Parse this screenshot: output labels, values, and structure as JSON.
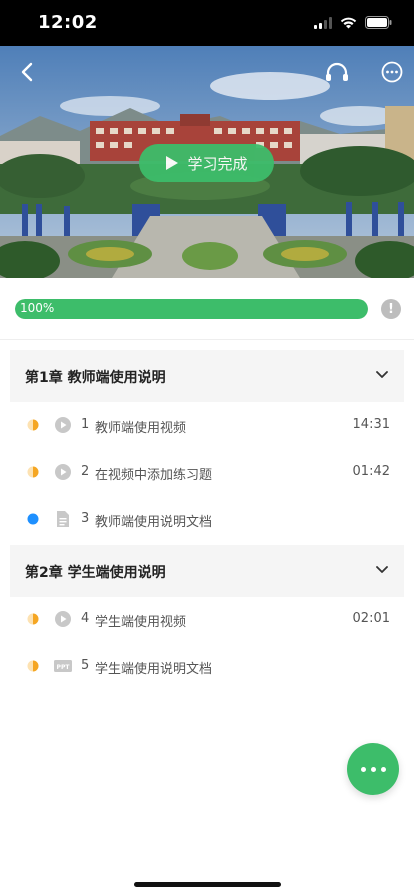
{
  "status_bar": {
    "time": "12:02"
  },
  "hero": {
    "play_label": "学习完成",
    "back_icon": "chevron-left-icon",
    "headphone_icon": "headphones-icon",
    "more_icon": "more-circle-icon"
  },
  "progress": {
    "value": 1.0,
    "label": "100%",
    "color": "#3dbd6a",
    "info_icon": "!"
  },
  "chapters": [
    {
      "title": "第1章  教师端使用说明"
    },
    {
      "title": "第2章  学生端使用说明"
    }
  ],
  "lessons": [
    {
      "num": "1",
      "title": "教师端使用视频",
      "duration": "14:31",
      "status": "half",
      "type": "video"
    },
    {
      "num": "2",
      "title": "在视频中添加练习题",
      "duration": "01:42",
      "status": "half",
      "type": "video"
    },
    {
      "num": "3",
      "title": "教师端使用说明文档",
      "duration": "",
      "status": "blue",
      "type": "doc"
    },
    {
      "num": "4",
      "title": "学生端使用视频",
      "duration": "02:01",
      "status": "half",
      "type": "video"
    },
    {
      "num": "5",
      "title": "学生端使用说明文档",
      "duration": "",
      "status": "half",
      "type": "ppt"
    }
  ],
  "colors": {
    "accent": "#3dbd6a",
    "status_half": "#f5a623",
    "status_blue": "#1e90ff"
  }
}
